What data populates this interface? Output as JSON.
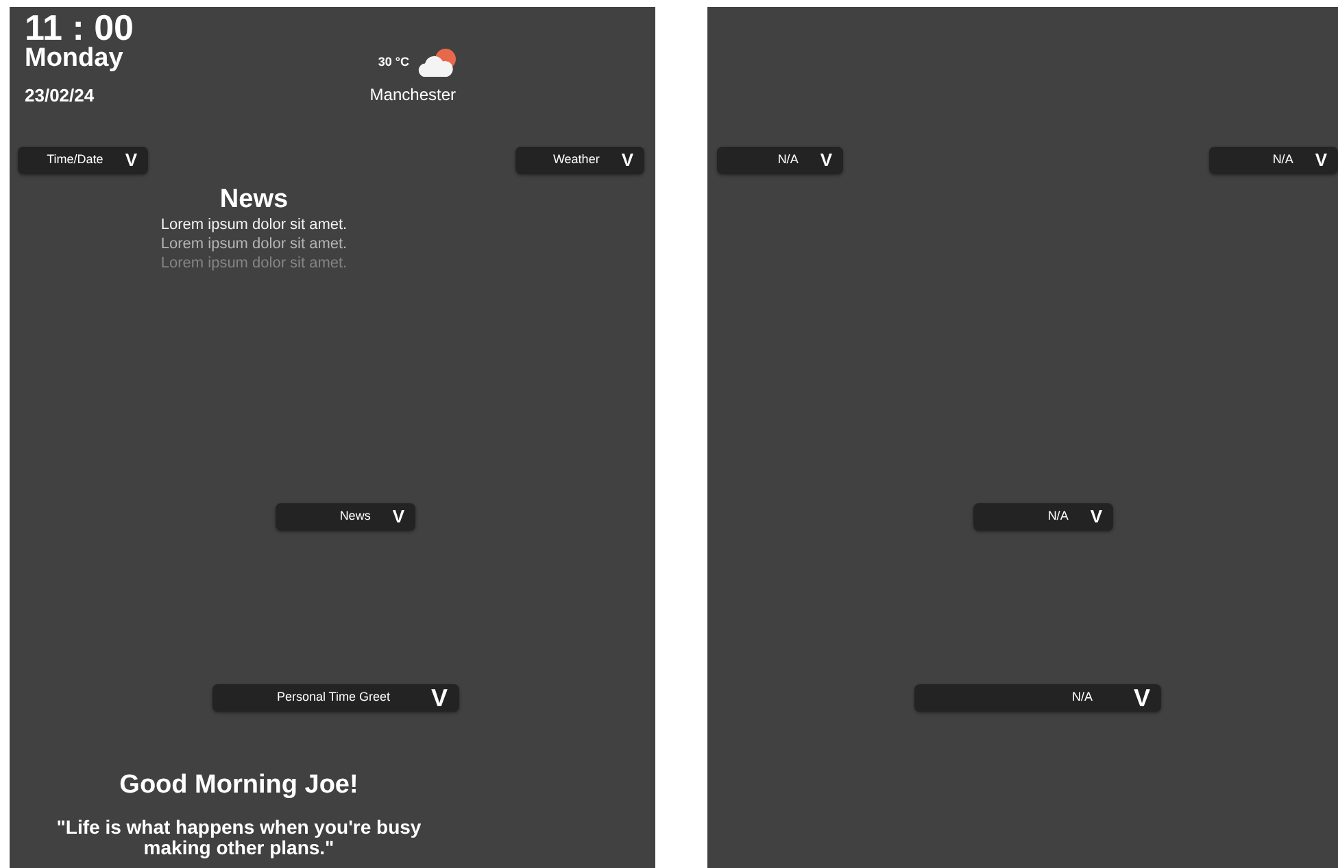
{
  "panels": [
    {
      "clock": {
        "time": "11 : 00",
        "day": "Monday",
        "date": "23/02/24"
      },
      "weather": {
        "temperature": "30 °C",
        "city": "Manchester"
      },
      "selectors": [
        {
          "label": "Time/Date",
          "caret": "V"
        },
        {
          "label": "Weather",
          "caret": "V"
        },
        {
          "label": "News",
          "caret": "V"
        },
        {
          "label": "Personal Time Greet",
          "caret": "V"
        }
      ],
      "news": {
        "title": "News",
        "items": [
          {
            "text": "Lorem ipsum dolor sit amet.",
            "color": "#f2f2f2"
          },
          {
            "text": "Lorem ipsum dolor sit amet.",
            "color": "#b4b4b4"
          },
          {
            "text": "Lorem ipsum dolor sit amet.",
            "color": "#858585"
          }
        ]
      },
      "greeting": {
        "title": "Good Morning Joe!",
        "quote": "\"Life is what happens when you're busy making other plans.\""
      }
    },
    {
      "selectors": [
        {
          "label": "N/A",
          "caret": "V"
        },
        {
          "label": "N/A",
          "caret": "V"
        },
        {
          "label": "N/A",
          "caret": "V"
        },
        {
          "label": "N/A",
          "caret": "V"
        }
      ]
    }
  ]
}
